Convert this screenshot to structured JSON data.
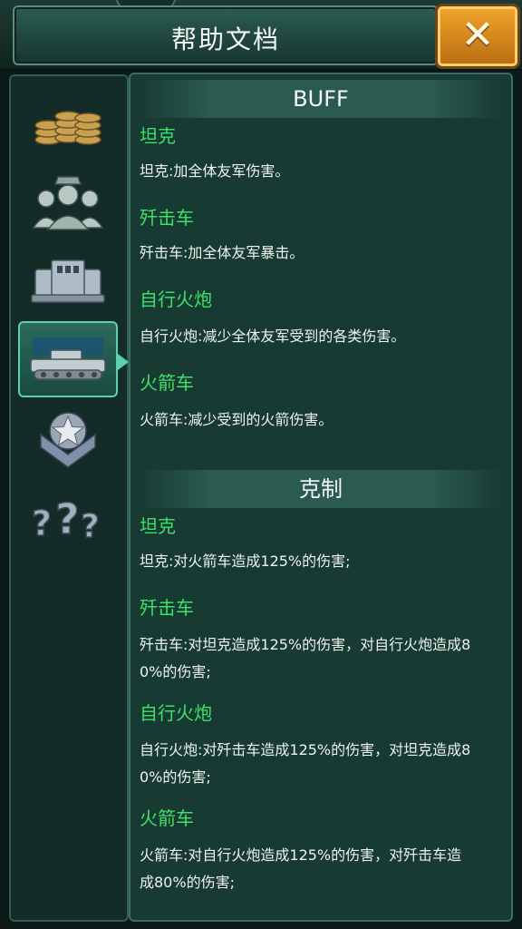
{
  "header": {
    "title": "帮助文档",
    "close_label": "✕"
  },
  "nav": {
    "items": [
      {
        "id": "coins",
        "icon": "coins-icon"
      },
      {
        "id": "officers",
        "icon": "officer-icon"
      },
      {
        "id": "buildings",
        "icon": "building-icon"
      },
      {
        "id": "vehicles",
        "icon": "tank-icon",
        "active": true
      },
      {
        "id": "rank",
        "icon": "rank-star-icon"
      },
      {
        "id": "help",
        "icon": "question-icon"
      }
    ]
  },
  "buff": {
    "title": "BUFF",
    "items": [
      {
        "name": "坦克",
        "desc": "坦克:加全体友军伤害。"
      },
      {
        "name": "歼击车",
        "desc": "歼击车:加全体友军暴击。"
      },
      {
        "name": "自行火炮",
        "desc": "自行火炮:减少全体友军受到的各类伤害。"
      },
      {
        "name": "火箭车",
        "desc": "火箭车:减少受到的火箭伤害。"
      }
    ]
  },
  "counter": {
    "title": "克制",
    "items": [
      {
        "name": "坦克",
        "desc": "坦克:对火箭车造成125%的伤害;"
      },
      {
        "name": "歼击车",
        "desc_l1": "歼击车:对坦克造成125%的伤害，对自行火炮造成8",
        "desc_l2": "0%的伤害;"
      },
      {
        "name": "自行火炮",
        "desc_l1": "自行火炮:对歼击车造成125%的伤害，对坦克造成8",
        "desc_l2": "0%的伤害;"
      },
      {
        "name": "火箭车",
        "desc_l1": "火箭车:对自行火炮造成125%的伤害，对歼击车造",
        "desc_l2": "成80%的伤害;"
      }
    ]
  },
  "colors": {
    "accent_green": "#3ee06a",
    "close_orange": "#f0a52b",
    "panel": "#173a33"
  }
}
